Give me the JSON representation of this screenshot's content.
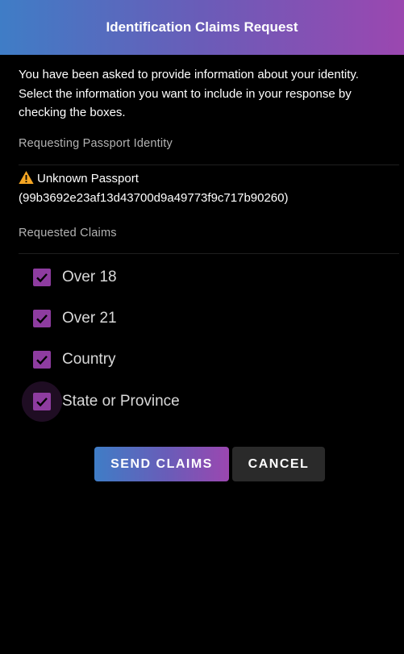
{
  "header": {
    "title": "Identification Claims Request"
  },
  "intro": {
    "text": "You have been asked to provide information about your identity. Select the information you want to include in your response by checking the boxes."
  },
  "passport_section": {
    "label": "Requesting Passport Identity",
    "name": "Unknown Passport",
    "id": "(99b3692e23af13d43700d9a49773f9c717b90260)",
    "warning_icon": "warning-triangle-icon",
    "warning_color": "#f5a623"
  },
  "claims_section": {
    "label": "Requested Claims",
    "items": [
      {
        "label": "Over 18",
        "checked": true
      },
      {
        "label": "Over 21",
        "checked": true
      },
      {
        "label": "Country",
        "checked": true
      },
      {
        "label": "State or Province",
        "checked": true
      }
    ],
    "checkbox_color": "#8e3ca0"
  },
  "actions": {
    "send_label": "SEND CLAIMS",
    "cancel_label": "CANCEL"
  }
}
